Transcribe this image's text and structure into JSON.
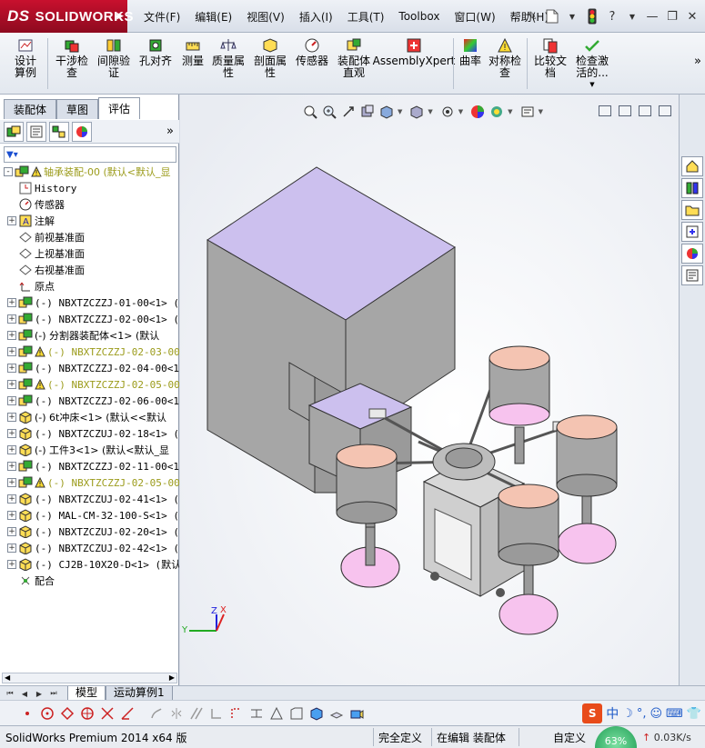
{
  "app": {
    "logo_text": "SOLIDWORKS",
    "logo_prefix": "DS"
  },
  "menus": [
    "文件(F)",
    "编辑(E)",
    "视图(V)",
    "插入(I)",
    "工具(T)",
    "Toolbox",
    "窗口(W)",
    "帮助(H)"
  ],
  "ribbon": {
    "buttons": [
      {
        "label": "设计算例",
        "icon": "design-study-icon"
      },
      {
        "label": "干涉检查",
        "icon": "interference-check-icon"
      },
      {
        "label": "间隙验证",
        "icon": "clearance-verification-icon"
      },
      {
        "label": "孔对齐",
        "icon": "hole-alignment-icon"
      },
      {
        "label": "测量",
        "icon": "measure-icon"
      },
      {
        "label": "质量属性",
        "icon": "mass-properties-icon"
      },
      {
        "label": "剖面属性",
        "icon": "section-properties-icon"
      },
      {
        "label": "传感器",
        "icon": "sensor-icon"
      },
      {
        "label": "装配体直观",
        "icon": "assembly-visualization-icon"
      },
      {
        "label": "AssemblyXpert",
        "icon": "assemblyxpert-icon"
      },
      {
        "label": "曲率",
        "icon": "curvature-icon"
      },
      {
        "label": "对称检查",
        "icon": "symmetry-check-icon"
      },
      {
        "label": "比较文档",
        "icon": "compare-documents-icon"
      },
      {
        "label": "检查激活的...",
        "icon": "check-active-icon"
      }
    ]
  },
  "panel_tabs": [
    "装配体",
    "草图",
    "评估"
  ],
  "active_panel_tab": "评估",
  "tree": [
    {
      "text": "轴承装配-00  (默认<默认_显",
      "expand": "-",
      "warn": true,
      "icon": "assembly-icon",
      "style": "mixed-dim"
    },
    {
      "text": "History",
      "expand": "",
      "icon": "history-icon",
      "style": "mono"
    },
    {
      "text": "传感器",
      "expand": "",
      "icon": "sensor-icon",
      "style": "mixed"
    },
    {
      "text": "注解",
      "expand": "+",
      "icon": "annotation-icon",
      "style": "mixed"
    },
    {
      "text": "前视基准面",
      "expand": "",
      "icon": "plane-icon",
      "style": "mixed"
    },
    {
      "text": "上视基准面",
      "expand": "",
      "icon": "plane-icon",
      "style": "mixed"
    },
    {
      "text": "右视基准面",
      "expand": "",
      "icon": "plane-icon",
      "style": "mixed"
    },
    {
      "text": "原点",
      "expand": "",
      "icon": "origin-icon",
      "style": "mixed"
    },
    {
      "text": "(-) NBXTZCZZJ-01-00<1> (默",
      "expand": "+",
      "icon": "subassembly-icon",
      "style": "mono"
    },
    {
      "text": "(-) NBXTZCZZJ-02-00<1> (默",
      "expand": "+",
      "icon": "subassembly-icon",
      "style": "mono"
    },
    {
      "text": "(-) 分割器装配体<1> (默认",
      "expand": "+",
      "icon": "subassembly-icon",
      "style": "mixed"
    },
    {
      "text": "(-) NBXTZCZZJ-02-03-00<",
      "expand": "+",
      "icon": "subassembly-icon",
      "warn": true,
      "style": "mono-dim"
    },
    {
      "text": "(-) NBXTZCZZJ-02-04-00<1>",
      "expand": "+",
      "icon": "subassembly-icon",
      "style": "mono"
    },
    {
      "text": "(-) NBXTZCZZJ-02-05-00<",
      "expand": "+",
      "icon": "subassembly-icon",
      "warn": true,
      "style": "mono-dim"
    },
    {
      "text": "(-) NBXTZCZZJ-02-06-00<1>",
      "expand": "+",
      "icon": "subassembly-icon",
      "style": "mono"
    },
    {
      "text": "(-) 6t冲床<1> (默认<<默认",
      "expand": "+",
      "icon": "part-icon",
      "style": "mixed"
    },
    {
      "text": "(-) NBXTZCZUJ-02-18<1> (默",
      "expand": "+",
      "icon": "part-icon",
      "style": "mono"
    },
    {
      "text": "(-) 工件3<1> (默认<默认_显",
      "expand": "+",
      "icon": "part-icon",
      "style": "mixed"
    },
    {
      "text": "(-) NBXTZCZZJ-02-11-00<1>",
      "expand": "+",
      "icon": "subassembly-icon",
      "style": "mono"
    },
    {
      "text": "(-) NBXTZCZZJ-02-05-00<",
      "expand": "+",
      "icon": "subassembly-icon",
      "warn": true,
      "style": "mono-dim"
    },
    {
      "text": "(-) NBXTZCZUJ-02-41<1> (默",
      "expand": "+",
      "icon": "part-icon",
      "style": "mono"
    },
    {
      "text": "(-) MAL-CM-32-100-S<1> (默",
      "expand": "+",
      "icon": "part-icon",
      "style": "mono"
    },
    {
      "text": "(-) NBXTZCZUJ-02-20<1> (默",
      "expand": "+",
      "icon": "part-icon",
      "style": "mono"
    },
    {
      "text": "(-) NBXTZCZUJ-02-42<1> (默",
      "expand": "+",
      "icon": "part-icon",
      "style": "mono"
    },
    {
      "text": "(-) CJ2B-10X20-D<1> (默认",
      "expand": "+",
      "icon": "part-icon",
      "style": "mono"
    },
    {
      "text": "配合",
      "expand": "",
      "icon": "mates-icon",
      "style": "mixed"
    }
  ],
  "axis_triad": {
    "x": "X",
    "y": "Y",
    "z": "Z"
  },
  "bottom_tabs": [
    "模型",
    "运动算例1"
  ],
  "status": {
    "app_version": "SolidWorks Premium 2014 x64 版",
    "definition": "完全定义",
    "edit_state": "在编辑 装配体",
    "unit_system": "自定义",
    "net_percent": "63%",
    "net_speed": "0.03K/s"
  },
  "ime": {
    "label": "中"
  },
  "colors": {
    "logo_red": "#c8102e",
    "model_lavender": "#ccc0ee",
    "model_gray": "#a6a6a6",
    "bowl_peach": "#f4c4b2",
    "base_pink": "#f7c3ee"
  }
}
